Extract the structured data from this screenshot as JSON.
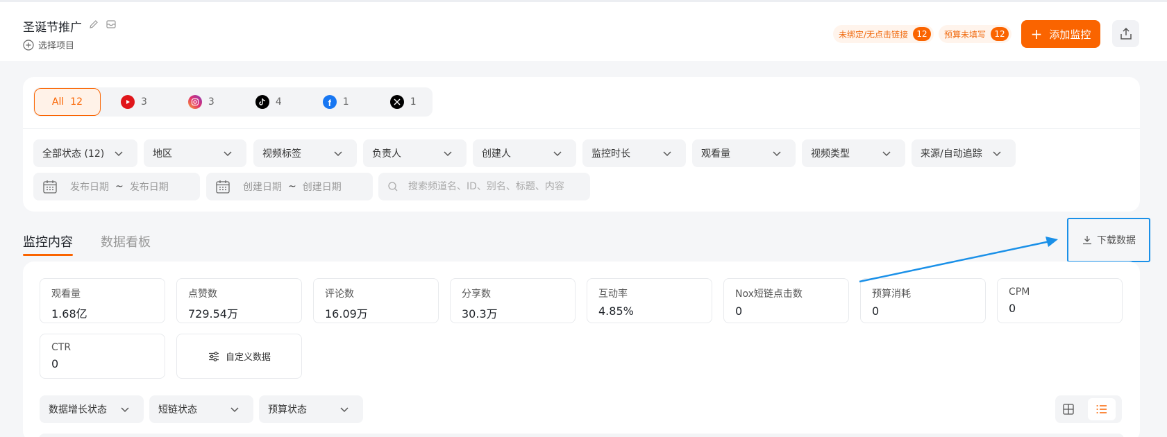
{
  "header": {
    "project_title": "圣诞节推广",
    "select_project_label": "选择项目",
    "warning_no_link_label": "未绑定/无点击链接",
    "warning_no_link_count": "12",
    "warning_budget_label": "预算未填写",
    "warning_budget_count": "12",
    "add_monitor_label": "添加监控",
    "accent_color": "#fa6400"
  },
  "platform_tabs": [
    {
      "label": "All",
      "count": "12",
      "icon": "all"
    },
    {
      "label": "",
      "count": "3",
      "icon": "youtube-icon"
    },
    {
      "label": "",
      "count": "3",
      "icon": "instagram-icon"
    },
    {
      "label": "",
      "count": "4",
      "icon": "tiktok-icon"
    },
    {
      "label": "",
      "count": "1",
      "icon": "facebook-icon"
    },
    {
      "label": "",
      "count": "1",
      "icon": "x-icon"
    }
  ],
  "filters": {
    "dropdowns": [
      "全部状态 (12)",
      "地区",
      "视频标签",
      "负责人",
      "创建人",
      "监控时长",
      "观看量",
      "视频类型",
      "来源/自动追踪"
    ],
    "publish_start_placeholder": "发布日期",
    "publish_end_placeholder": "发布日期",
    "create_start_placeholder": "创建日期",
    "create_end_placeholder": "创建日期",
    "range_separator": "~",
    "search_placeholder": "搜索频道名、ID、别名、标题、内容"
  },
  "tabs": {
    "active": "监控内容",
    "inactive": "数据看板"
  },
  "download_label": "下载数据",
  "stats": [
    {
      "label": "观看量",
      "value": "1.68亿"
    },
    {
      "label": "点赞数",
      "value": "729.54万"
    },
    {
      "label": "评论数",
      "value": "16.09万"
    },
    {
      "label": "分享数",
      "value": "30.3万"
    },
    {
      "label": "互动率",
      "value": "4.85%"
    },
    {
      "label": "Nox短链点击数",
      "value": "0"
    },
    {
      "label": "预算消耗",
      "value": "0"
    },
    {
      "label": "CPM",
      "value": "0"
    },
    {
      "label": "CTR",
      "value": "0"
    }
  ],
  "custom_data_label": "自定义数据",
  "sub_filters": [
    "数据增长状态",
    "短链状态",
    "预算状态"
  ]
}
